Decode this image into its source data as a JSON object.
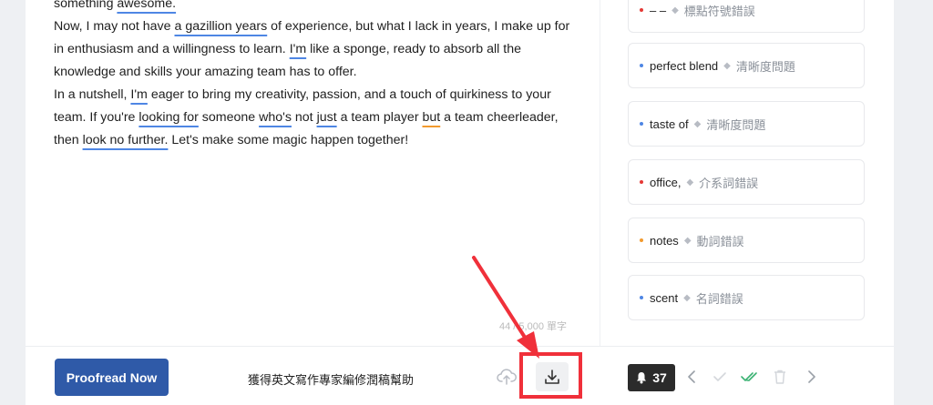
{
  "editor": {
    "paragraphs": [
      {
        "segments": [
          {
            "text": "something "
          },
          {
            "text": "awesome.",
            "u": "blue"
          }
        ]
      },
      {
        "segments": [
          {
            "text": "Now, I may not have "
          },
          {
            "text": "a gazillion years",
            "u": "blue"
          },
          {
            "text": " of experience, but what I lack in years, I make up for in enthusiasm and a willingness to learn. "
          },
          {
            "text": "I'm",
            "u": "blue"
          },
          {
            "text": " like a sponge, ready to absorb all the knowledge and skills your amazing team has to offer."
          }
        ]
      },
      {
        "segments": [
          {
            "text": "In a nutshell, "
          },
          {
            "text": "I'm",
            "u": "blue"
          },
          {
            "text": " eager to bring my creativity, passion, and a touch of quirkiness to your team. If you're "
          },
          {
            "text": "looking for",
            "u": "blue"
          },
          {
            "text": " someone "
          },
          {
            "text": "who's",
            "u": "blue"
          },
          {
            "text": " not "
          },
          {
            "text": "just",
            "u": "blue"
          },
          {
            "text": " a team player "
          },
          {
            "text": "but",
            "u": "orange"
          },
          {
            "text": " a team cheerleader, then "
          },
          {
            "text": "look no further.",
            "u": "blue"
          },
          {
            "text": " Let's make some magic happen together!"
          }
        ]
      }
    ],
    "word_count": "44 / 5,000 單字"
  },
  "suggestions": [
    {
      "word": "– –",
      "category": "標點符號錯誤",
      "dot_color": "#e53935"
    },
    {
      "word": "perfect blend",
      "category": "清晰度問題",
      "dot_color": "#4e86e4"
    },
    {
      "word": "taste of",
      "category": "清晰度問題",
      "dot_color": "#4e86e4"
    },
    {
      "word": "office,",
      "category": "介系詞錯誤",
      "dot_color": "#e53935"
    },
    {
      "word": "notes",
      "category": "動詞錯誤",
      "dot_color": "#f29a2e"
    },
    {
      "word": "scent",
      "category": "名詞錯誤",
      "dot_color": "#4e86e4"
    }
  ],
  "bottom": {
    "proofread_label": "Proofread Now",
    "expert_text": "獲得英文寫作專家編修潤稿幫助",
    "issue_count": "37"
  },
  "colors": {
    "primary": "#2f5aa8",
    "underline_blue": "#4e86e4",
    "underline_orange": "#f29a2e",
    "highlight_red": "#f0303a"
  }
}
